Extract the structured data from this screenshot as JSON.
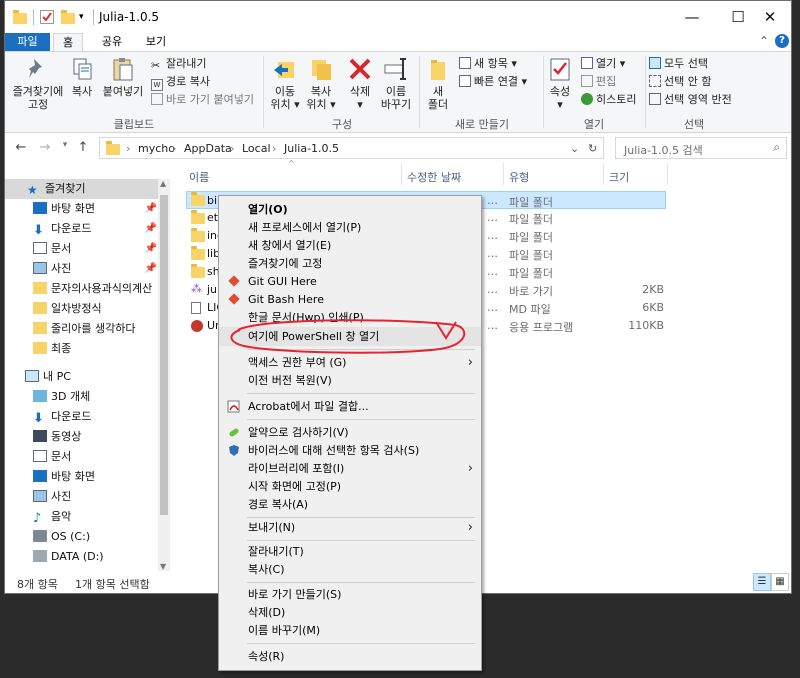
{
  "window": {
    "title": "Julia-1.0.5",
    "controls": {
      "minimize": "—",
      "maximize": "☐",
      "close": "✕"
    }
  },
  "tabs": {
    "file": "파일",
    "home": "홈",
    "share": "공유",
    "view": "보기"
  },
  "ribbon": {
    "clipboard": {
      "pin_label_1": "즐겨찾기에",
      "pin_label_2": "고정",
      "copy": "복사",
      "paste": "붙여넣기",
      "cut": "잘라내기",
      "copy_path": "경로 복사",
      "paste_shortcut": "바로 가기 붙여넣기",
      "group": "클립보드"
    },
    "organize": {
      "move_1": "이동",
      "move_2": "위치 ▾",
      "copy_1": "복사",
      "copy_2": "위치 ▾",
      "delete_1": "삭제",
      "delete_2": "▾",
      "rename_1": "이름",
      "rename_2": "바꾸기",
      "group": "구성"
    },
    "new": {
      "folder_1": "새",
      "folder_2": "폴더",
      "new_item": "새 항목 ▾",
      "easy_access": "빠른 연결 ▾",
      "group": "새로 만들기"
    },
    "open": {
      "properties_1": "속성",
      "properties_2": "▾",
      "open": "열기 ▾",
      "edit": "편집",
      "history": "히스토리",
      "group": "열기"
    },
    "select": {
      "select_all": "모두 선택",
      "select_none": "선택 안 함",
      "invert": "선택 영역 반전",
      "group": "선택"
    }
  },
  "address": {
    "crumbs": [
      "mycho",
      "AppData",
      "Local",
      "Julia-1.0.5"
    ],
    "search_placeholder": "Julia-1.0.5 검색"
  },
  "nav": {
    "quick_access": "즐겨찾기",
    "pinned": [
      "바탕 화면",
      "다운로드",
      "문서",
      "사진"
    ],
    "folders": [
      "문자의사용과식의계산",
      "일차방정식",
      "줄리아를 생각하다",
      "최종"
    ],
    "this_pc": "내 PC",
    "pc_items": [
      "3D 개체",
      "다운로드",
      "동영상",
      "문서",
      "바탕 화면",
      "사진",
      "음악",
      "OS (C:)",
      "DATA (D:)"
    ]
  },
  "columns": {
    "name": "이름",
    "date": "수정한 날짜",
    "type": "유형",
    "size": "크기"
  },
  "files": [
    {
      "name": "bin",
      "date": "…",
      "type": "파일 폴더",
      "size": "",
      "kind": "folder",
      "selected": true
    },
    {
      "name": "etc",
      "date": "…",
      "type": "파일 폴더",
      "size": "",
      "kind": "folder"
    },
    {
      "name": "incl",
      "date": "…",
      "type": "파일 폴더",
      "size": "",
      "kind": "folder"
    },
    {
      "name": "lib",
      "date": "…",
      "type": "파일 폴더",
      "size": "",
      "kind": "folder"
    },
    {
      "name": "sha",
      "date": "…",
      "type": "파일 폴더",
      "size": "",
      "kind": "folder"
    },
    {
      "name": "julia",
      "date": "…",
      "type": "바로 가기",
      "size": "2KB",
      "kind": "shortcut"
    },
    {
      "name": "LIC",
      "date": "…",
      "type": "MD 파일",
      "size": "6KB",
      "kind": "doc"
    },
    {
      "name": "Uni",
      "date": "…",
      "type": "응용 프로그램",
      "size": "110KB",
      "kind": "app"
    }
  ],
  "status": {
    "count": "8개 항목",
    "selected": "1개 항목 선택함"
  },
  "context_menu": {
    "open": "열기(O)",
    "open_new_process": "새 프로세스에서 열기(P)",
    "open_new_window": "새 창에서 열기(E)",
    "pin_quick": "즐겨찾기에 고정",
    "git_gui": "Git GUI Here",
    "git_bash": "Git Bash Here",
    "hwp_print": "한글 문서(Hwp) 인쇄(P)",
    "powershell": "여기에 PowerShell 창 열기",
    "give_access": "액세스 권한 부여 (G)",
    "restore": "이전 버전 복원(V)",
    "acrobat": "Acrobat에서 파일 결합...",
    "alyac": "알약으로 검사하기(V)",
    "virus_scan": "바이러스에 대해 선택한 항목 검사(S)",
    "include_library": "라이브러리에 포함(I)",
    "pin_start": "시작 화면에 고정(P)",
    "copy_path": "경로 복사(A)",
    "send_to": "보내기(N)",
    "cut": "잘라내기(T)",
    "copy": "복사(C)",
    "create_shortcut": "바로 가기 만들기(S)",
    "delete": "삭제(D)",
    "rename": "이름 바꾸기(M)",
    "properties": "속성(R)"
  },
  "colors": {
    "accent": "#1a6fc3",
    "selection": "#cce8ff",
    "annotation": "#e8232f",
    "folder": "#f7d368"
  }
}
